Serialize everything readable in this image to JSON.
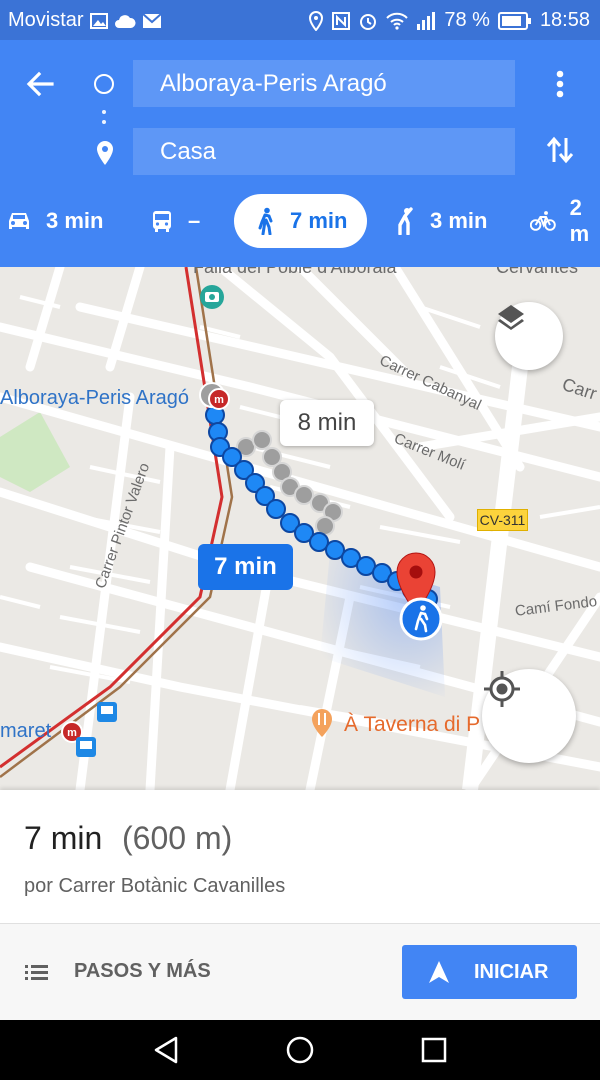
{
  "status_bar": {
    "carrier": "Movistar",
    "battery": "78 %",
    "time": "18:58"
  },
  "directions": {
    "origin": "Alboraya-Peris Aragó",
    "destination": "Casa",
    "modes": [
      {
        "mode": "car",
        "icon": "car-icon",
        "time": "3 min"
      },
      {
        "mode": "transit",
        "icon": "bus-icon",
        "time": "–"
      },
      {
        "mode": "walk",
        "icon": "walk-icon",
        "time": "7 min",
        "selected": true
      },
      {
        "mode": "ride",
        "icon": "ride-hail-icon",
        "time": "3 min"
      },
      {
        "mode": "bike",
        "icon": "bicycle-icon",
        "time": "2 m"
      }
    ]
  },
  "map": {
    "labels": {
      "top_street": "Falla del Poble d'Alboraia",
      "cervantes": "Cervantes",
      "cabanyal": "Carrer Cabanyal",
      "moli": "Carrer Molí",
      "pintor": "Carrer Pintor Valero",
      "cami_fondo": "Camí Fondo",
      "carr": "Carr",
      "station": "Alboraya-Peris Aragó",
      "maret": "maret",
      "cv_road": "CV-311",
      "poi": "À Taverna di P"
    },
    "route_time_main": "7 min",
    "route_time_alt": "8 min",
    "colors": {
      "route": "#1a73e8",
      "alt_route": "#9e9e9e",
      "metro": "#c62828",
      "pin": "#ea4335"
    }
  },
  "summary": {
    "time": "7 min",
    "distance": "(600 m)",
    "via": "por Carrer Botànic Cavanilles"
  },
  "actions": {
    "steps_label": "PASOS Y MÁS",
    "start_label": "INICIAR"
  }
}
